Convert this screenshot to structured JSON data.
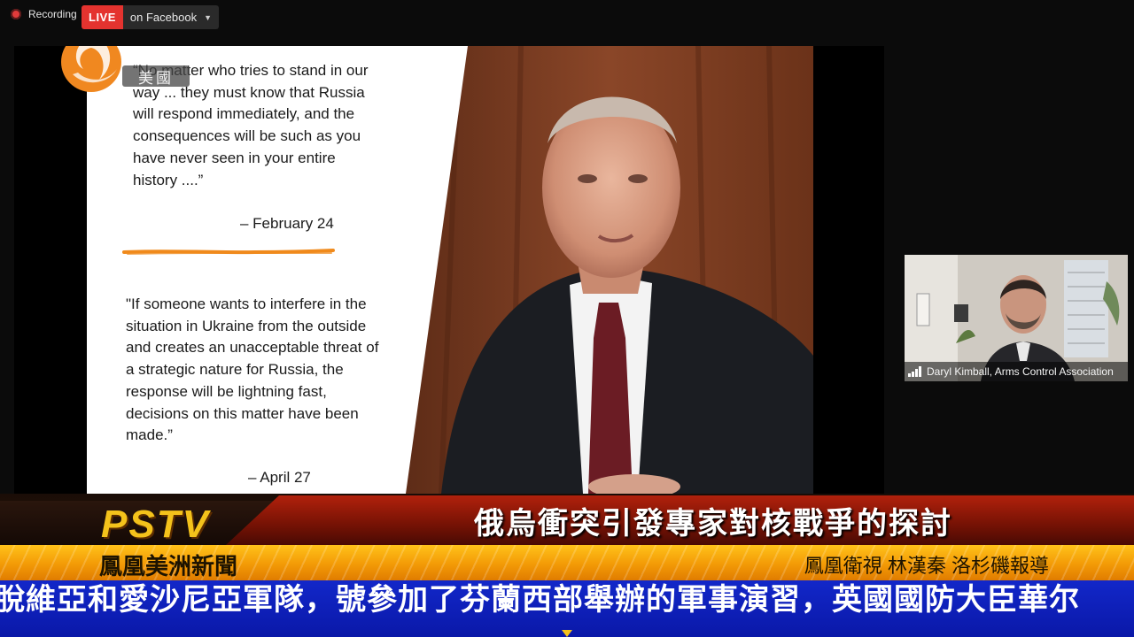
{
  "topbar": {
    "recording_label": "Recording",
    "live_label": "LIVE",
    "destination_label": "on Facebook"
  },
  "slide": {
    "quote1": "“No matter who tries to stand in our way ... they must know that Russia will respond immediately, and the consequences will be such as you have never seen in your entire history ....”",
    "quote1_date": "– February 24",
    "quote2": "\"If someone wants to interfere in the situation in Ukraine from the outside and creates an unacceptable threat of a strategic nature for Russia, the response will be lightning fast, decisions on this matter have been made.”",
    "quote2_date": "– April 27"
  },
  "logo": {
    "badge_text": "美國"
  },
  "participant": {
    "name": "Daryl Kimball, Arms Control Association"
  },
  "news": {
    "channel": "PSTV",
    "headline": "俄烏衝突引發專家對核戰爭的探討",
    "bureau": "鳳凰美洲新聞",
    "reporter": "鳳凰衛視 林漢秦 洛杉磯報導",
    "ticker": "脫維亞和愛沙尼亞軍隊，號參加了芬蘭西部舉辦的軍事演習，英國國防大臣華尔"
  },
  "colors": {
    "live": "#e4332f",
    "headline_red": "#b1210c",
    "orange_band": "#f39a06",
    "ticker_blue": "#1227c9",
    "pstv_yellow": "#f4c21b"
  }
}
